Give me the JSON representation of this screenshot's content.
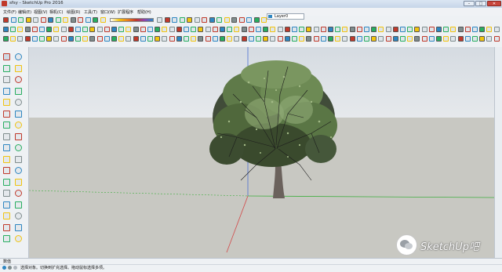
{
  "window": {
    "title": "sfsy - SketchUp Pro 2016",
    "controls": [
      "minimize",
      "maximize",
      "close"
    ]
  },
  "menu": {
    "items": [
      "文件(F)",
      "编辑(E)",
      "视图(V)",
      "相机(C)",
      "绘图(R)",
      "工具(T)",
      "窗口(W)",
      "扩展程序",
      "帮助(H)"
    ]
  },
  "toolbar": {
    "layer_dropdown": "Layer0",
    "accent_colors": [
      "#c0392b",
      "#2e86c1",
      "#27ae60",
      "#f1c40f",
      "#7f8c8d"
    ]
  },
  "left_palette": {
    "tool_icons": [
      "select-icon",
      "component-icon",
      "paint-bucket-icon",
      "eraser-icon",
      "line-icon",
      "freehand-icon",
      "rectangle-icon",
      "rotated-rectangle-icon",
      "circle-icon",
      "polygon-icon",
      "arc-icon",
      "pie-icon",
      "move-icon",
      "push-pull-icon",
      "rotate-icon",
      "follow-me-icon",
      "scale-icon",
      "offset-icon",
      "tape-measure-icon",
      "dimension-icon",
      "protractor-icon",
      "text-icon",
      "axes-icon",
      "3d-text-icon",
      "orbit-icon",
      "pan-icon",
      "zoom-icon",
      "zoom-window-icon",
      "zoom-extents-icon",
      "previous-view-icon",
      "position-camera-icon",
      "walk-icon",
      "look-around-icon",
      "section-plane-icon"
    ]
  },
  "viewport": {
    "sky_color": "#dfe4e8",
    "ground_color": "#c7c7c1",
    "axis_colors": {
      "red": "#d24a4a",
      "green": "#3fae3f",
      "blue": "#4a6fd2"
    }
  },
  "status": {
    "measure_label": "数值",
    "hint_text": "选择对象。切换到扩充选择。拖动鼠标选择多项。"
  },
  "watermark": {
    "text": "SketchUp吧"
  }
}
